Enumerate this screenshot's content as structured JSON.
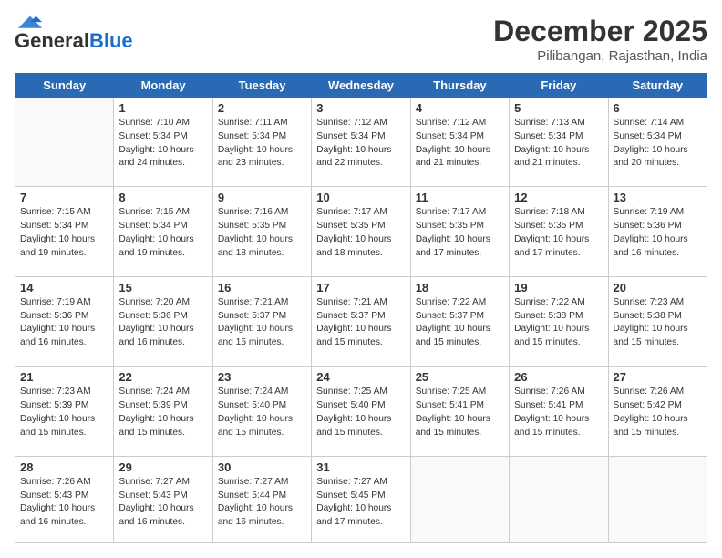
{
  "header": {
    "logo_general": "General",
    "logo_blue": "Blue",
    "month_title": "December 2025",
    "location": "Pilibangan, Rajasthan, India"
  },
  "days_of_week": [
    "Sunday",
    "Monday",
    "Tuesday",
    "Wednesday",
    "Thursday",
    "Friday",
    "Saturday"
  ],
  "weeks": [
    [
      {
        "day": "",
        "text": ""
      },
      {
        "day": "1",
        "text": "Sunrise: 7:10 AM\nSunset: 5:34 PM\nDaylight: 10 hours\nand 24 minutes."
      },
      {
        "day": "2",
        "text": "Sunrise: 7:11 AM\nSunset: 5:34 PM\nDaylight: 10 hours\nand 23 minutes."
      },
      {
        "day": "3",
        "text": "Sunrise: 7:12 AM\nSunset: 5:34 PM\nDaylight: 10 hours\nand 22 minutes."
      },
      {
        "day": "4",
        "text": "Sunrise: 7:12 AM\nSunset: 5:34 PM\nDaylight: 10 hours\nand 21 minutes."
      },
      {
        "day": "5",
        "text": "Sunrise: 7:13 AM\nSunset: 5:34 PM\nDaylight: 10 hours\nand 21 minutes."
      },
      {
        "day": "6",
        "text": "Sunrise: 7:14 AM\nSunset: 5:34 PM\nDaylight: 10 hours\nand 20 minutes."
      }
    ],
    [
      {
        "day": "7",
        "text": "Sunrise: 7:15 AM\nSunset: 5:34 PM\nDaylight: 10 hours\nand 19 minutes."
      },
      {
        "day": "8",
        "text": "Sunrise: 7:15 AM\nSunset: 5:34 PM\nDaylight: 10 hours\nand 19 minutes."
      },
      {
        "day": "9",
        "text": "Sunrise: 7:16 AM\nSunset: 5:35 PM\nDaylight: 10 hours\nand 18 minutes."
      },
      {
        "day": "10",
        "text": "Sunrise: 7:17 AM\nSunset: 5:35 PM\nDaylight: 10 hours\nand 18 minutes."
      },
      {
        "day": "11",
        "text": "Sunrise: 7:17 AM\nSunset: 5:35 PM\nDaylight: 10 hours\nand 17 minutes."
      },
      {
        "day": "12",
        "text": "Sunrise: 7:18 AM\nSunset: 5:35 PM\nDaylight: 10 hours\nand 17 minutes."
      },
      {
        "day": "13",
        "text": "Sunrise: 7:19 AM\nSunset: 5:36 PM\nDaylight: 10 hours\nand 16 minutes."
      }
    ],
    [
      {
        "day": "14",
        "text": "Sunrise: 7:19 AM\nSunset: 5:36 PM\nDaylight: 10 hours\nand 16 minutes."
      },
      {
        "day": "15",
        "text": "Sunrise: 7:20 AM\nSunset: 5:36 PM\nDaylight: 10 hours\nand 16 minutes."
      },
      {
        "day": "16",
        "text": "Sunrise: 7:21 AM\nSunset: 5:37 PM\nDaylight: 10 hours\nand 15 minutes."
      },
      {
        "day": "17",
        "text": "Sunrise: 7:21 AM\nSunset: 5:37 PM\nDaylight: 10 hours\nand 15 minutes."
      },
      {
        "day": "18",
        "text": "Sunrise: 7:22 AM\nSunset: 5:37 PM\nDaylight: 10 hours\nand 15 minutes."
      },
      {
        "day": "19",
        "text": "Sunrise: 7:22 AM\nSunset: 5:38 PM\nDaylight: 10 hours\nand 15 minutes."
      },
      {
        "day": "20",
        "text": "Sunrise: 7:23 AM\nSunset: 5:38 PM\nDaylight: 10 hours\nand 15 minutes."
      }
    ],
    [
      {
        "day": "21",
        "text": "Sunrise: 7:23 AM\nSunset: 5:39 PM\nDaylight: 10 hours\nand 15 minutes."
      },
      {
        "day": "22",
        "text": "Sunrise: 7:24 AM\nSunset: 5:39 PM\nDaylight: 10 hours\nand 15 minutes."
      },
      {
        "day": "23",
        "text": "Sunrise: 7:24 AM\nSunset: 5:40 PM\nDaylight: 10 hours\nand 15 minutes."
      },
      {
        "day": "24",
        "text": "Sunrise: 7:25 AM\nSunset: 5:40 PM\nDaylight: 10 hours\nand 15 minutes."
      },
      {
        "day": "25",
        "text": "Sunrise: 7:25 AM\nSunset: 5:41 PM\nDaylight: 10 hours\nand 15 minutes."
      },
      {
        "day": "26",
        "text": "Sunrise: 7:26 AM\nSunset: 5:41 PM\nDaylight: 10 hours\nand 15 minutes."
      },
      {
        "day": "27",
        "text": "Sunrise: 7:26 AM\nSunset: 5:42 PM\nDaylight: 10 hours\nand 15 minutes."
      }
    ],
    [
      {
        "day": "28",
        "text": "Sunrise: 7:26 AM\nSunset: 5:43 PM\nDaylight: 10 hours\nand 16 minutes."
      },
      {
        "day": "29",
        "text": "Sunrise: 7:27 AM\nSunset: 5:43 PM\nDaylight: 10 hours\nand 16 minutes."
      },
      {
        "day": "30",
        "text": "Sunrise: 7:27 AM\nSunset: 5:44 PM\nDaylight: 10 hours\nand 16 minutes."
      },
      {
        "day": "31",
        "text": "Sunrise: 7:27 AM\nSunset: 5:45 PM\nDaylight: 10 hours\nand 17 minutes."
      },
      {
        "day": "",
        "text": ""
      },
      {
        "day": "",
        "text": ""
      },
      {
        "day": "",
        "text": ""
      }
    ]
  ]
}
